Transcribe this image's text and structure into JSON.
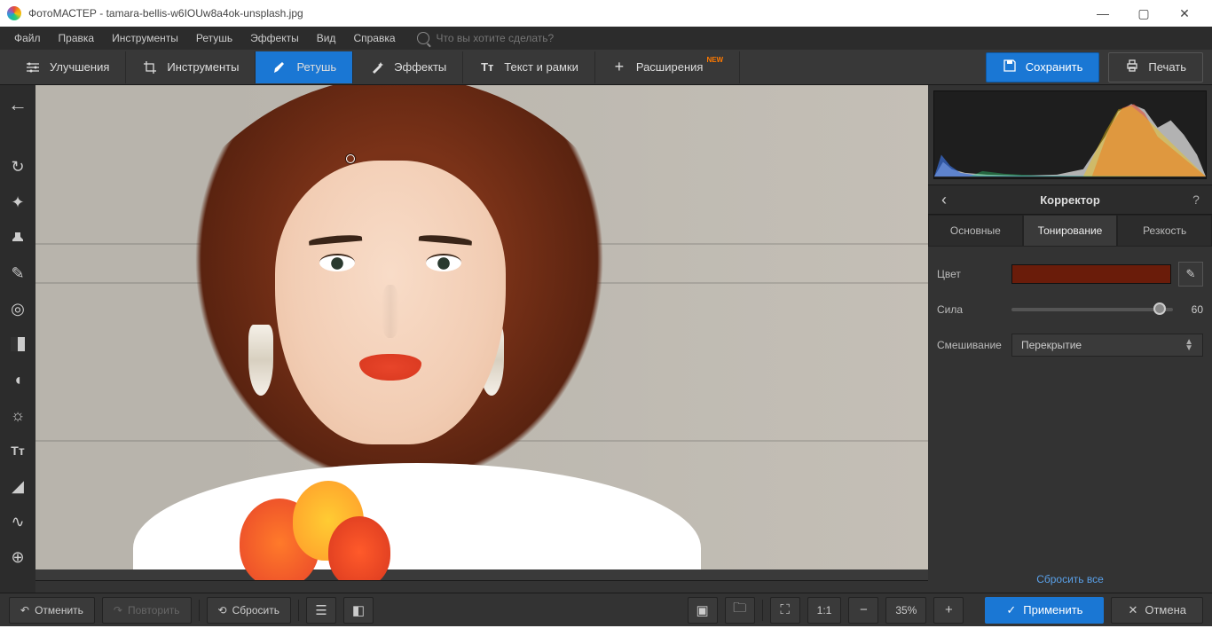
{
  "title": "ФотоМАСТЕР - tamara-bellis-w6IOUw8a4ok-unsplash.jpg",
  "menubar": [
    "Файл",
    "Правка",
    "Инструменты",
    "Ретушь",
    "Эффекты",
    "Вид",
    "Справка"
  ],
  "search_placeholder": "Что вы хотите сделать?",
  "toolbar": {
    "tabs": [
      "Улучшения",
      "Инструменты",
      "Ретушь",
      "Эффекты",
      "Текст и рамки",
      "Расширения"
    ],
    "new_badge": "NEW",
    "save": "Сохранить",
    "print": "Печать"
  },
  "panel": {
    "title": "Корректор",
    "tabs": [
      "Основные",
      "Тонирование",
      "Резкость"
    ],
    "color_label": "Цвет",
    "color_value": "#6a1c0a",
    "strength_label": "Сила",
    "strength_value": "60",
    "blend_label": "Смешивание",
    "blend_value": "Перекрытие",
    "reset_all": "Сбросить все"
  },
  "footer": {
    "undo": "Отменить",
    "redo": "Повторить",
    "reset": "Сбросить",
    "zoom": "35%",
    "ratio": "1:1",
    "apply": "Применить",
    "cancel": "Отмена"
  }
}
